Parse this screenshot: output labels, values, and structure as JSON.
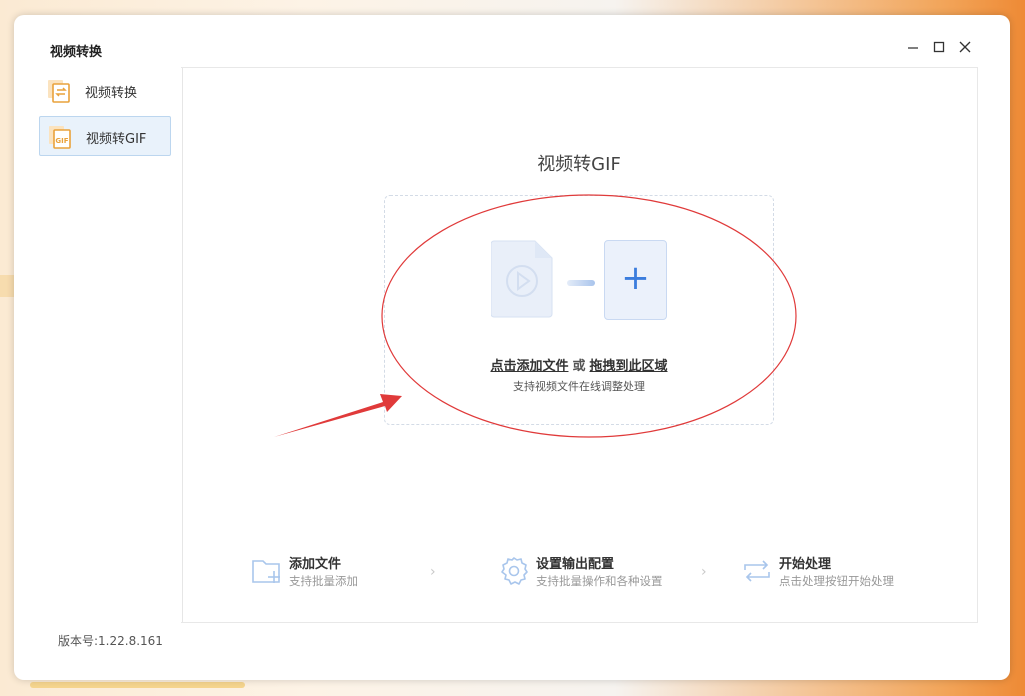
{
  "window": {
    "title": "视频转换",
    "minimize_glyph": "—",
    "maximize_glyph": "☐",
    "close_glyph": "✕"
  },
  "sidebar": {
    "items": [
      {
        "label": "视频转换",
        "icon": "video-convert-icon",
        "active": false
      },
      {
        "label": "视频转GIF",
        "icon": "gif-icon",
        "active": true
      }
    ]
  },
  "main": {
    "title": "视频转GIF",
    "dropzone": {
      "click_add": "点击添加文件",
      "or": "或",
      "drag_here": "拖拽到此区域",
      "hint": "支持视频文件在线调整处理"
    },
    "steps": [
      {
        "title": "添加文件",
        "subtitle": "支持批量添加",
        "icon": "add-folder-icon"
      },
      {
        "title": "设置输出配置",
        "subtitle": "支持批量操作和各种设置",
        "icon": "gear-icon"
      },
      {
        "title": "开始处理",
        "subtitle": "点击处理按钮开始处理",
        "icon": "repeat-icon"
      }
    ]
  },
  "footer": {
    "version": "版本号:1.22.8.161"
  },
  "colors": {
    "accent": "#3b7ddd",
    "annotation": "#e03a3a",
    "icon_orange": "#e9a23b"
  }
}
